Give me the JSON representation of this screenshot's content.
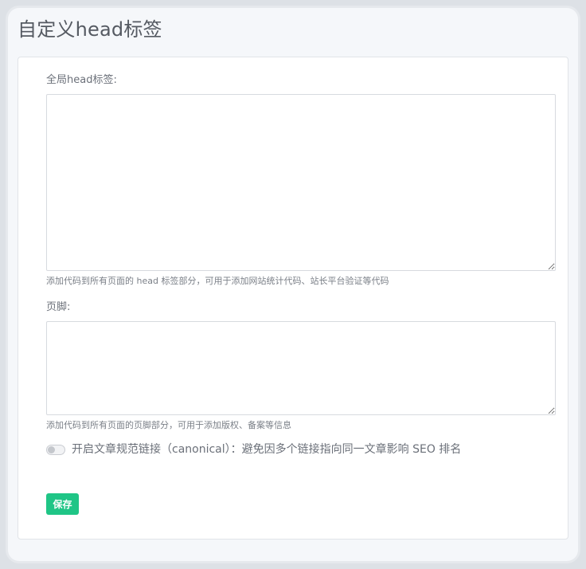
{
  "page": {
    "title": "自定义head标签"
  },
  "form": {
    "head_field": {
      "label": "全局head标签:",
      "value": "",
      "help": "添加代码到所有页面的 head 标签部分，可用于添加网站统计代码、站长平台验证等代码"
    },
    "footer_field": {
      "label": "页脚:",
      "value": "",
      "help": "添加代码到所有页面的页脚部分，可用于添加版权、备案等信息"
    },
    "canonical_toggle": {
      "label": "开启文章规范链接（canonical）：避免因多个链接指向同一文章影响 SEO 排名",
      "enabled": false
    },
    "save_label": "保存"
  },
  "colors": {
    "accent": "#1fc586",
    "background": "#f5f7fa"
  }
}
